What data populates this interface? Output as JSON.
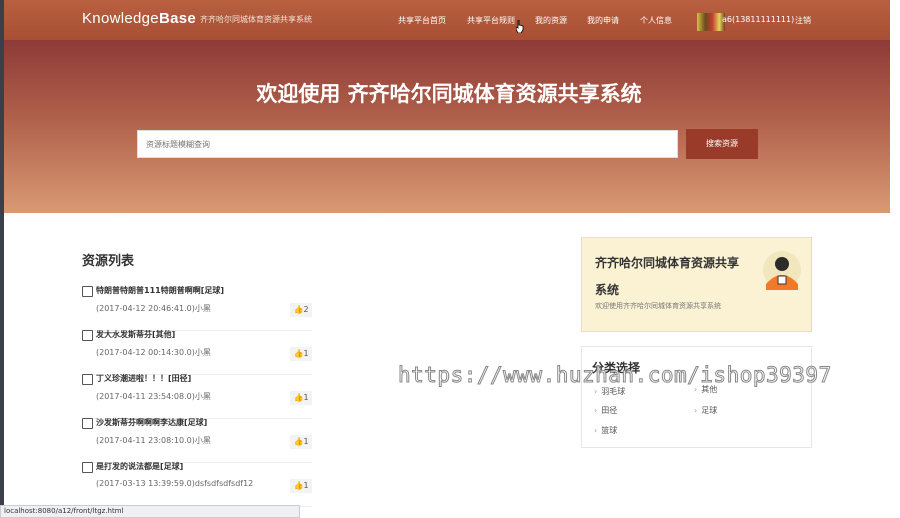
{
  "nav": {
    "logo_light": "Knowledge",
    "logo_bold": "Base",
    "subtitle": "齐齐哈尔同城体育资源共享系统",
    "items": [
      {
        "label": "共享平台首页"
      },
      {
        "label": "共享平台规则"
      },
      {
        "label": "我的资源"
      },
      {
        "label": "我的申请"
      },
      {
        "label": "个人信息"
      },
      {
        "label": "a6(13811111111)"
      },
      {
        "label": "注销"
      }
    ]
  },
  "hero": {
    "title": "欢迎使用 齐齐哈尔同城体育资源共享系统",
    "search_placeholder": "资源标题模糊查询",
    "search_button": "搜索资源"
  },
  "resources": {
    "heading": "资源列表",
    "items": [
      {
        "title": "特朗普特朗普111特朗普啊啊[足球]",
        "meta": "(2017-04-12 20:46:41.0)小黑",
        "likes": "2"
      },
      {
        "title": "发大水发斯蒂芬[其他]",
        "meta": "(2017-04-12 00:14:30.0)小黑",
        "likes": "1"
      },
      {
        "title": "丁义珍潮进啦！！！[田径]",
        "meta": "(2017-04-11 23:54:08.0)小黑",
        "likes": "1"
      },
      {
        "title": "沙发斯蒂芬啊啊啊李达康[足球]",
        "meta": "(2017-04-11 23:08:10.0)小黑",
        "likes": "1"
      },
      {
        "title": "是打发的说法都是[足球]",
        "meta": "(2017-03-13 13:39:59.0)dsfsdfsdfsdf12",
        "likes": "1"
      }
    ]
  },
  "sidebar": {
    "card_title": "齐齐哈尔同城体育资源共享系统",
    "card_desc": "欢迎使用齐齐哈尔同城体育资源共享系统",
    "category_heading": "分类选择",
    "categories": [
      "羽毛球",
      "其他",
      "田径",
      "足球",
      "篮球"
    ]
  },
  "watermark": "https://www.huzhan.com/ishop39397",
  "statusbar": "localhost:8080/a12/front/ltgz.html",
  "colors": {
    "nav_bg": "#b45a3c",
    "search_button": "#9a3a28",
    "card_bg": "#fbf2d3"
  }
}
